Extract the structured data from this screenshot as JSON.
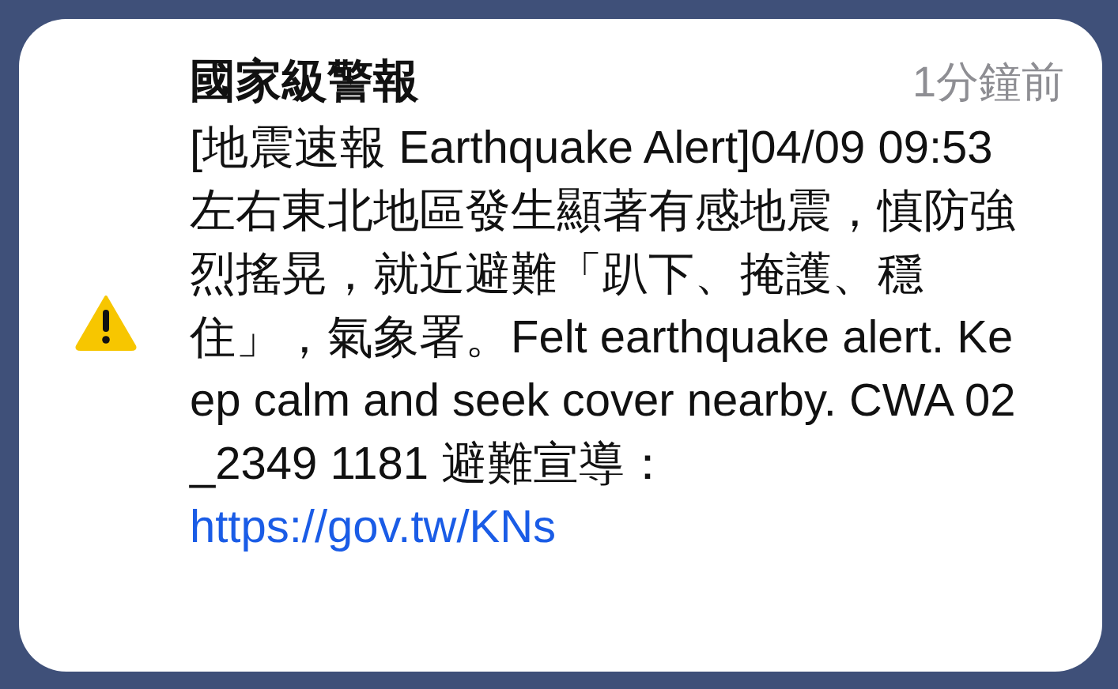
{
  "notification": {
    "kind": "warning",
    "title": "國家級警報",
    "time": "1分鐘前",
    "body": "[地震速報 Earthquake Alert]04/09 09:53左右東北地區發生顯著有感地震，慎防強烈搖晃，就近避難「趴下、掩護、穩住」，氣象署。Felt earthquake alert. Keep calm and seek cover nearby. CWA 02_2349 1181 避難宣導：",
    "link": "https://gov.tw/KNs"
  }
}
